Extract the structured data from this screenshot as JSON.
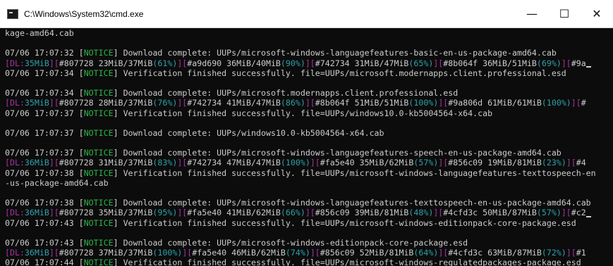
{
  "window": {
    "title": "C:\\Windows\\System32\\cmd.exe",
    "minimize": "—",
    "maximize": "☐",
    "close": "✕"
  },
  "console": {
    "lines": [
      {
        "type": "plain",
        "text": "kage-amd64.cab"
      },
      {
        "type": "blank"
      },
      {
        "type": "notice",
        "ts": "07/06 17:07:32",
        "tag": "NOTICE",
        "msg": "Download complete: UUPs/microsoft-windows-languagefeatures-basic-en-us-package-amd64.cab"
      },
      {
        "type": "dl",
        "parts": [
          [
            "dl",
            "[DL:"
          ],
          [
            "val",
            "35MiB"
          ],
          [
            "dl",
            "]["
          ],
          [
            "wh",
            "#807728 23MiB/37MiB"
          ],
          [
            "val",
            "(61%)"
          ],
          [
            "dl",
            "]["
          ],
          [
            "wh",
            "#a9d690 36MiB/40MiB"
          ],
          [
            "val",
            "(90%)"
          ],
          [
            "dl",
            "]["
          ],
          [
            "wh",
            "#742734 31MiB/47MiB"
          ],
          [
            "val",
            "(65%)"
          ],
          [
            "dl",
            "]["
          ],
          [
            "wh",
            "#8b064f 36MiB/51MiB"
          ],
          [
            "val",
            "(69%)"
          ],
          [
            "dl",
            "]["
          ],
          [
            "wh",
            "#9a"
          ]
        ],
        "cursor": true
      },
      {
        "type": "notice",
        "ts": "07/06 17:07:34",
        "tag": "NOTICE",
        "msg": "Verification finished successfully. file=UUPs/microsoft.modernapps.client.professional.esd"
      },
      {
        "type": "blank"
      },
      {
        "type": "notice",
        "ts": "07/06 17:07:34",
        "tag": "NOTICE",
        "msg": "Download complete: UUPs/microsoft.modernapps.client.professional.esd"
      },
      {
        "type": "dl",
        "parts": [
          [
            "dl",
            "[DL:"
          ],
          [
            "val",
            "35MiB"
          ],
          [
            "dl",
            "]["
          ],
          [
            "wh",
            "#807728 28MiB/37MiB"
          ],
          [
            "val",
            "(76%)"
          ],
          [
            "dl",
            "]["
          ],
          [
            "wh",
            "#742734 41MiB/47MiB"
          ],
          [
            "val",
            "(86%)"
          ],
          [
            "dl",
            "]["
          ],
          [
            "wh",
            "#8b064f 51MiB/51MiB"
          ],
          [
            "val",
            "(100%)"
          ],
          [
            "dl",
            "]["
          ],
          [
            "wh",
            "#9a806d 61MiB/61MiB"
          ],
          [
            "val",
            "(100%)"
          ],
          [
            "dl",
            "]["
          ],
          [
            "wh",
            "#"
          ]
        ]
      },
      {
        "type": "notice",
        "ts": "07/06 17:07:37",
        "tag": "NOTICE",
        "msg": "Verification finished successfully. file=UUPs/windows10.0-kb5004564-x64.cab"
      },
      {
        "type": "blank"
      },
      {
        "type": "notice",
        "ts": "07/06 17:07:37",
        "tag": "NOTICE",
        "msg": "Download complete: UUPs/windows10.0-kb5004564-x64.cab"
      },
      {
        "type": "blank"
      },
      {
        "type": "notice",
        "ts": "07/06 17:07:37",
        "tag": "NOTICE",
        "msg": "Download complete: UUPs/microsoft-windows-languagefeatures-speech-en-us-package-amd64.cab"
      },
      {
        "type": "dl",
        "parts": [
          [
            "dl",
            "[DL:"
          ],
          [
            "val",
            "36MiB"
          ],
          [
            "dl",
            "]["
          ],
          [
            "wh",
            "#807728 31MiB/37MiB"
          ],
          [
            "val",
            "(83%)"
          ],
          [
            "dl",
            "]["
          ],
          [
            "wh",
            "#742734 47MiB/47MiB"
          ],
          [
            "val",
            "(100%)"
          ],
          [
            "dl",
            "]["
          ],
          [
            "wh",
            "#fa5e40 35MiB/62MiB"
          ],
          [
            "val",
            "(57%)"
          ],
          [
            "dl",
            "]["
          ],
          [
            "wh",
            "#856c09 19MiB/81MiB"
          ],
          [
            "val",
            "(23%)"
          ],
          [
            "dl",
            "]["
          ],
          [
            "wh",
            "#4"
          ]
        ]
      },
      {
        "type": "notice",
        "ts": "07/06 17:07:38",
        "tag": "NOTICE",
        "msg": "Verification finished successfully. file=UUPs/microsoft-windows-languagefeatures-texttospeech-en"
      },
      {
        "type": "plain",
        "text": "-us-package-amd64.cab"
      },
      {
        "type": "blank"
      },
      {
        "type": "notice",
        "ts": "07/06 17:07:38",
        "tag": "NOTICE",
        "msg": "Download complete: UUPs/microsoft-windows-languagefeatures-texttospeech-en-us-package-amd64.cab"
      },
      {
        "type": "dl",
        "parts": [
          [
            "dl",
            "[DL:"
          ],
          [
            "val",
            "36MiB"
          ],
          [
            "dl",
            "]["
          ],
          [
            "wh",
            "#807728 35MiB/37MiB"
          ],
          [
            "val",
            "(95%)"
          ],
          [
            "dl",
            "]["
          ],
          [
            "wh",
            "#fa5e40 41MiB/62MiB"
          ],
          [
            "val",
            "(66%)"
          ],
          [
            "dl",
            "]["
          ],
          [
            "wh",
            "#856c09 39MiB/81MiB"
          ],
          [
            "val",
            "(48%)"
          ],
          [
            "dl",
            "]["
          ],
          [
            "wh",
            "#4cfd3c 50MiB/87MiB"
          ],
          [
            "val",
            "(57%)"
          ],
          [
            "dl",
            "]["
          ],
          [
            "wh",
            "#c2"
          ]
        ],
        "cursor": true
      },
      {
        "type": "notice",
        "ts": "07/06 17:07:43",
        "tag": "NOTICE",
        "msg": "Verification finished successfully. file=UUPs/microsoft-windows-editionpack-core-package.esd"
      },
      {
        "type": "blank"
      },
      {
        "type": "notice",
        "ts": "07/06 17:07:43",
        "tag": "NOTICE",
        "msg": "Download complete: UUPs/microsoft-windows-editionpack-core-package.esd"
      },
      {
        "type": "dl",
        "parts": [
          [
            "dl",
            "[DL:"
          ],
          [
            "val",
            "36MiB"
          ],
          [
            "dl",
            "]["
          ],
          [
            "wh",
            "#807728 37MiB/37MiB"
          ],
          [
            "val",
            "(100%)"
          ],
          [
            "dl",
            "]["
          ],
          [
            "wh",
            "#fa5e40 46MiB/62MiB"
          ],
          [
            "val",
            "(74%)"
          ],
          [
            "dl",
            "]["
          ],
          [
            "wh",
            "#856c09 52MiB/81MiB"
          ],
          [
            "val",
            "(64%)"
          ],
          [
            "dl",
            "]["
          ],
          [
            "wh",
            "#4cfd3c 63MiB/87MiB"
          ],
          [
            "val",
            "(72%)"
          ],
          [
            "dl",
            "]["
          ],
          [
            "wh",
            "#1"
          ]
        ]
      },
      {
        "type": "notice",
        "ts": "07/06 17:07:44",
        "tag": "NOTICE",
        "msg": "Verification finished successfully. file=UUPs/microsoft-windows-regulatedpackages-package.esd"
      }
    ]
  }
}
